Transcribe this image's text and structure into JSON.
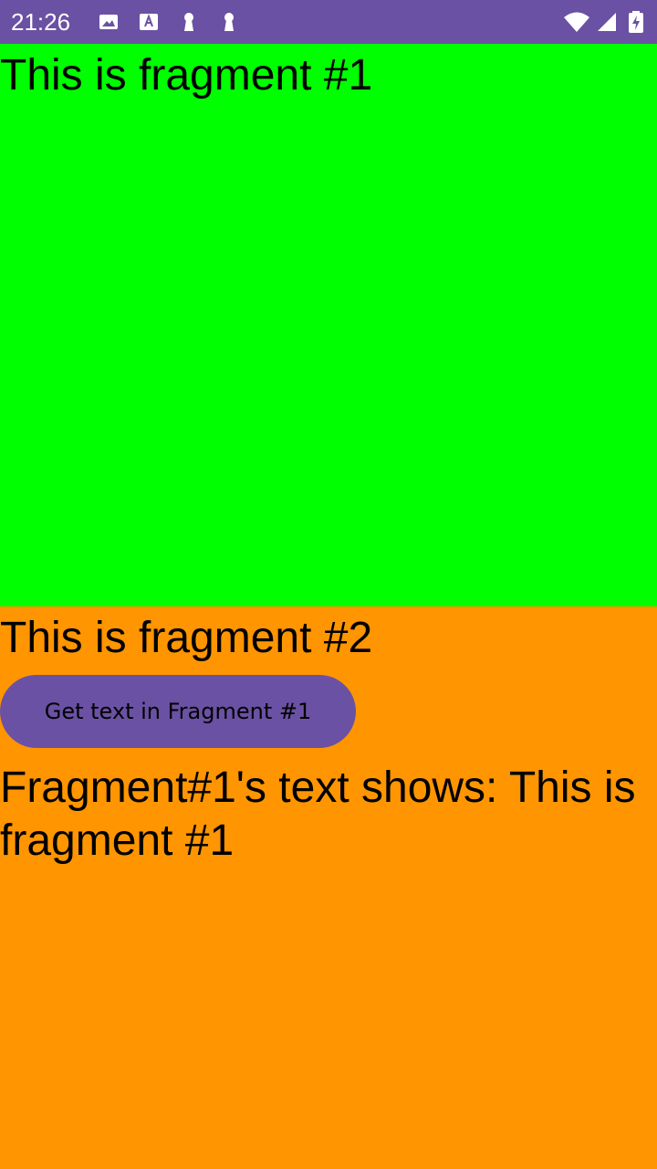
{
  "status_bar": {
    "time": "21:26",
    "left_icons": [
      "image-icon",
      "text-a-icon",
      "keyhole-icon",
      "keyhole-icon"
    ],
    "right_icons": [
      "wifi-icon",
      "signal-icon",
      "battery-charging-icon"
    ],
    "background": "#6a51a3"
  },
  "fragment1": {
    "text": "This is fragment #1",
    "background": "#00ff00"
  },
  "fragment2": {
    "text": "This is fragment #2",
    "button_label": "Get text in Fragment #1",
    "result_text": "Fragment#1's text shows: This is fragment #1",
    "background": "#ff9500",
    "button_color": "#6a51a3"
  }
}
